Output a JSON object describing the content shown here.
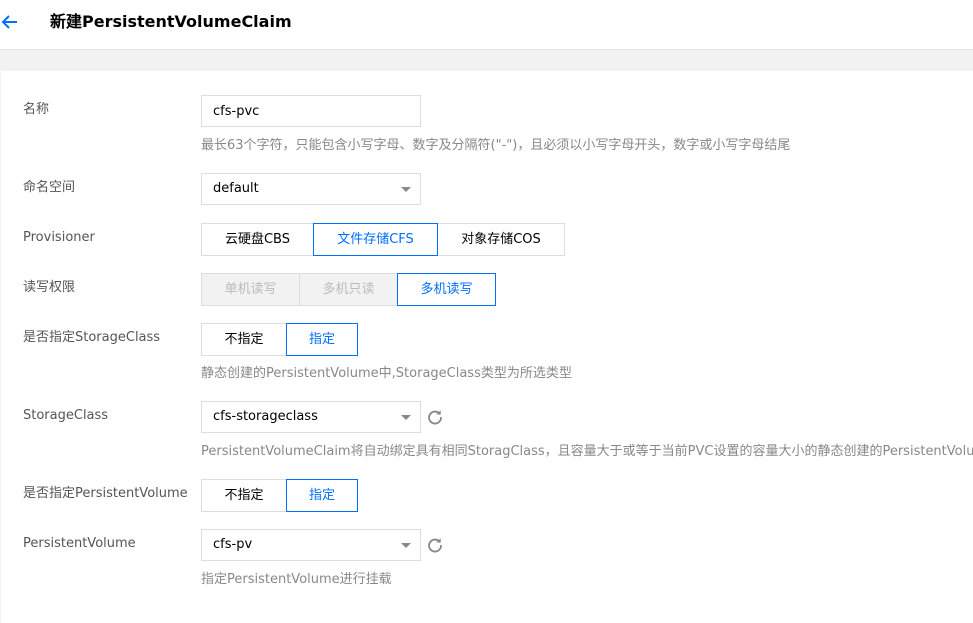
{
  "header": {
    "title": "新建PersistentVolumeClaim"
  },
  "form": {
    "name": {
      "label": "名称",
      "value": "cfs-pvc",
      "help": "最长63个字符，只能包含小写字母、数字及分隔符(\"-\")，且必须以小写字母开头，数字或小写字母结尾"
    },
    "namespace": {
      "label": "命名空间",
      "value": "default"
    },
    "provisioner": {
      "label": "Provisioner",
      "options": [
        "云硬盘CBS",
        "文件存储CFS",
        "对象存储COS"
      ],
      "selected": "文件存储CFS"
    },
    "access": {
      "label": "读写权限",
      "options": [
        "单机读写",
        "多机只读",
        "多机读写"
      ],
      "selected": "多机读写"
    },
    "specify_sc": {
      "label": "是否指定StorageClass",
      "options": [
        "不指定",
        "指定"
      ],
      "selected": "指定",
      "help": "静态创建的PersistentVolume中,StorageClass类型为所选类型"
    },
    "storage_class": {
      "label": "StorageClass",
      "value": "cfs-storageclass",
      "help": "PersistentVolumeClaim将自动绑定具有相同StoragClass，且容量大于或等于当前PVC设置的容量大小的静态创建的PersistentVolume"
    },
    "specify_pv": {
      "label": "是否指定PersistentVolume",
      "options": [
        "不指定",
        "指定"
      ],
      "selected": "指定"
    },
    "pv": {
      "label": "PersistentVolume",
      "value": "cfs-pv",
      "help": "指定PersistentVolume进行挂载"
    }
  },
  "icons": {
    "back": "back-arrow-icon",
    "refresh": "refresh-icon",
    "caret": "chevron-down-icon"
  },
  "colors": {
    "accent": "#006eff"
  }
}
